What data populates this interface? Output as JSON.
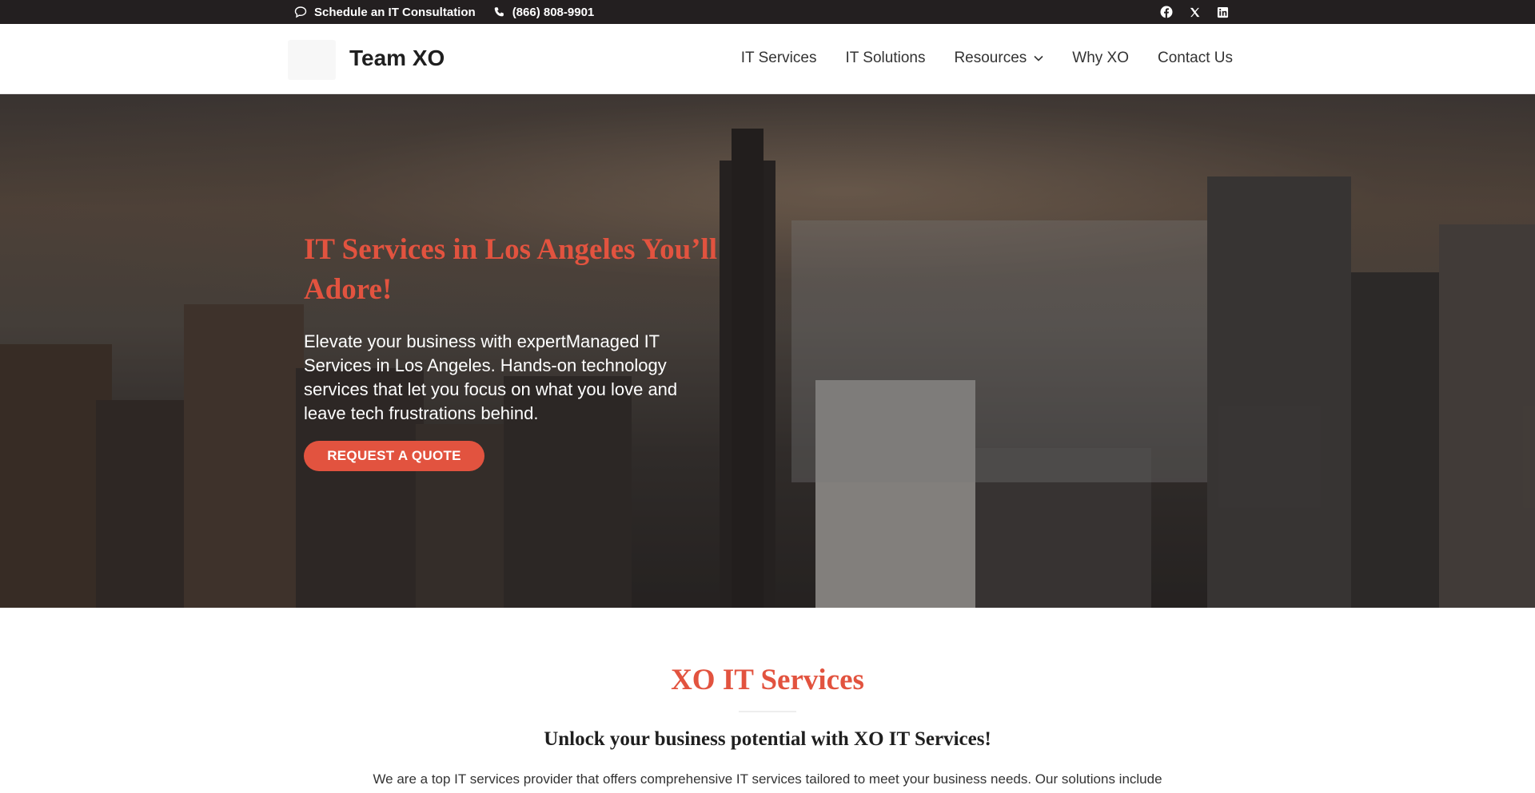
{
  "topbar": {
    "consult_label": "Schedule an IT Consultation",
    "phone_label": "(866) 808-9901",
    "social": [
      "facebook-icon",
      "x-icon",
      "linkedin-icon"
    ]
  },
  "header": {
    "brand": "Team XO",
    "nav": [
      {
        "label": "IT Services"
      },
      {
        "label": "IT Solutions"
      },
      {
        "label": "Resources"
      },
      {
        "label": "Why XO"
      },
      {
        "label": "Contact Us"
      }
    ]
  },
  "hero": {
    "title": "IT Services in Los Angeles You’ll Adore!",
    "text": "Elevate your business with expertManaged IT Services in Los Angeles. Hands-on technology services that let you focus on what you love and leave tech frustrations behind.",
    "button": "REQUEST A QUOTE"
  },
  "section": {
    "title": "XO IT Services",
    "subtitle": "Unlock your business potential with XO IT Services!",
    "body": "We are a top IT services provider that offers comprehensive IT services tailored to meet your business needs. Our solutions include"
  },
  "colors": {
    "accent": "#e2533f",
    "topbar": "#231f20"
  }
}
